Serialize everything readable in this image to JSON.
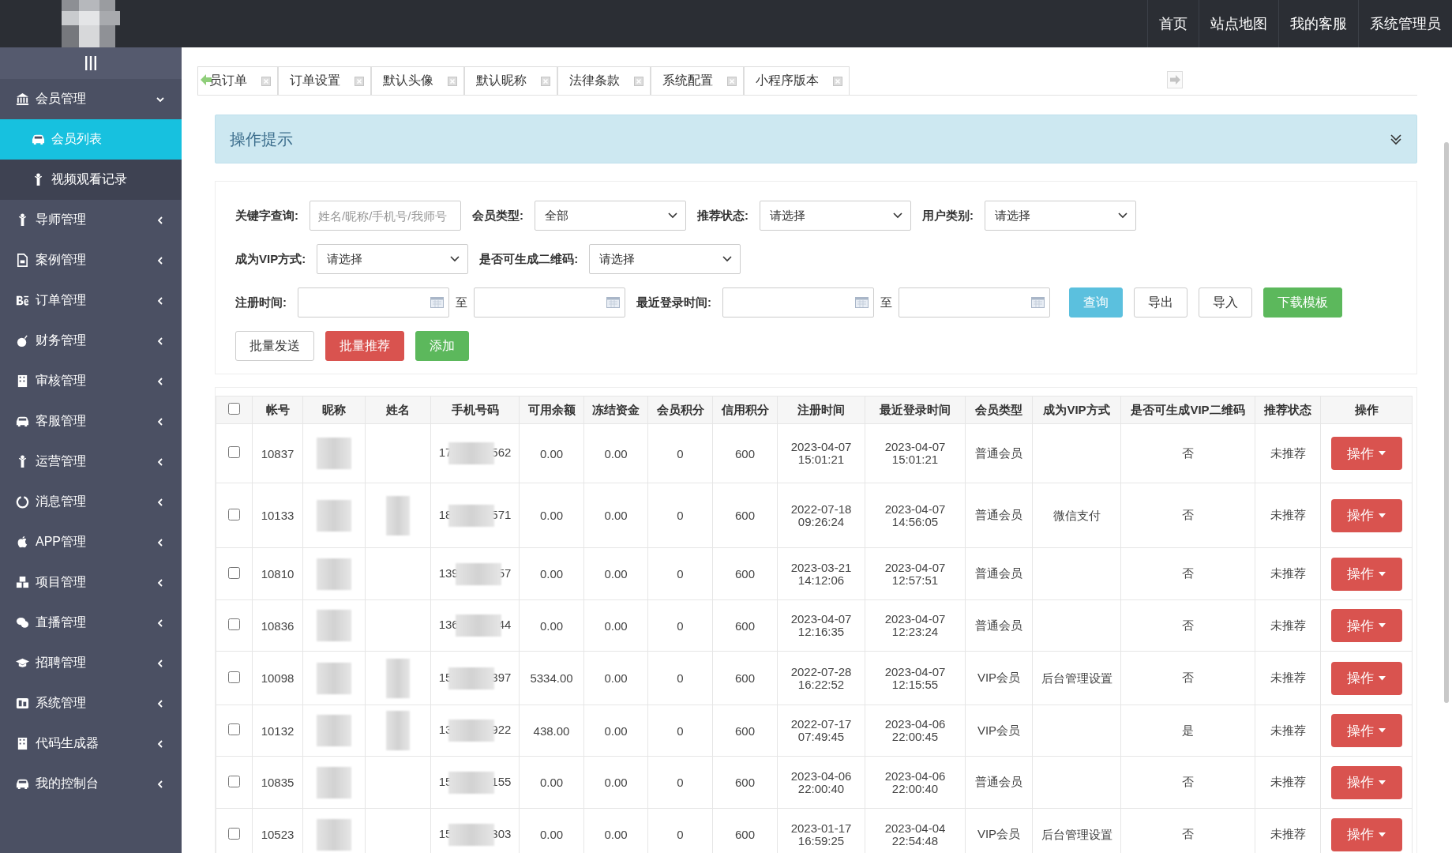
{
  "top_nav": [
    {
      "label": "首页"
    },
    {
      "label": "站点地图"
    },
    {
      "label": "我的客服"
    },
    {
      "label": "系统管理员"
    }
  ],
  "sidebar": {
    "items": [
      {
        "label": "会员管理",
        "expanded": true,
        "children": [
          {
            "label": "会员列表",
            "selected": true
          },
          {
            "label": "视频观看记录",
            "selected": false
          }
        ]
      },
      {
        "label": "导师管理",
        "expanded": false
      },
      {
        "label": "案例管理",
        "expanded": false
      },
      {
        "label": "订单管理",
        "expanded": false
      },
      {
        "label": "财务管理",
        "expanded": false
      },
      {
        "label": "审核管理",
        "expanded": false
      },
      {
        "label": "客服管理",
        "expanded": false
      },
      {
        "label": "运营管理",
        "expanded": false
      },
      {
        "label": "消息管理",
        "expanded": false
      },
      {
        "label": "APP管理",
        "expanded": false
      },
      {
        "label": "项目管理",
        "expanded": false
      },
      {
        "label": "直播管理",
        "expanded": false
      },
      {
        "label": "招聘管理",
        "expanded": false
      },
      {
        "label": "系统管理",
        "expanded": false
      },
      {
        "label": "代码生成器",
        "expanded": false
      },
      {
        "label": "我的控制台",
        "expanded": false
      }
    ]
  },
  "tabs": [
    {
      "label": "员订单",
      "selected": false
    },
    {
      "label": "订单设置",
      "selected": false
    },
    {
      "label": "默认头像",
      "selected": false
    },
    {
      "label": "默认昵称",
      "selected": false
    },
    {
      "label": "法律条款",
      "selected": false
    },
    {
      "label": "系统配置",
      "selected": false
    },
    {
      "label": "小程序版本",
      "selected": false
    }
  ],
  "tip_panel": {
    "title": "操作提示",
    "expanded": false
  },
  "filters": [
    [
      {
        "kind": "input",
        "label": "关键字查询:",
        "placeholder": "姓名/昵称/手机号/我师号"
      },
      {
        "kind": "select",
        "label": "会员类型:",
        "value": "全部"
      },
      {
        "kind": "select",
        "label": "推荐状态:",
        "value": "请选择"
      },
      {
        "kind": "select",
        "label": "用户类别:",
        "value": "请选择"
      }
    ],
    [
      {
        "kind": "select",
        "label": "成为VIP方式:",
        "value": "请选择"
      },
      {
        "kind": "select",
        "label": "是否可生成二维码:",
        "value": "请选择"
      }
    ],
    [
      {
        "kind": "range",
        "label": "注册时间:",
        "separator": "至"
      },
      {
        "kind": "range",
        "label": "最近登录时间:",
        "separator": "至"
      },
      {
        "kind": "button",
        "label": "查询"
      },
      {
        "kind": "button",
        "label": "导出"
      },
      {
        "kind": "button",
        "label": "导入"
      },
      {
        "kind": "button",
        "label": "下载模板"
      }
    ]
  ],
  "actions": [
    {
      "label": "批量发送"
    },
    {
      "label": "批量推荐"
    },
    {
      "label": "添加"
    }
  ],
  "table": {
    "select_all": {
      "checked": false
    },
    "columns": [
      "帐号",
      "昵称",
      "姓名",
      "手机号码",
      "可用余额",
      "冻结资金",
      "会员积分",
      "信用积分",
      "注册时间",
      "最近登录时间",
      "会员类型",
      "成为VIP方式",
      "是否可生成VIP二维码",
      "推荐状态",
      "操作"
    ],
    "rows": [
      {
        "checked": false,
        "account": "10837",
        "nickname_redacted": true,
        "name_redacted": false,
        "phone_start": "17",
        "phone_end": "562",
        "balance": "0.00",
        "frozen": "0.00",
        "points": "0",
        "credit": "600",
        "registered": "2023-04-07 15:01:21",
        "last_login": "2023-04-07 15:01:21",
        "member_type": "普通会员",
        "qr": "否",
        "recommend": "未推荐",
        "action": "操作"
      },
      {
        "checked": false,
        "account": "10133",
        "nickname_redacted": true,
        "name_redacted": true,
        "phone_start": "18",
        "phone_end": "571",
        "balance": "0.00",
        "frozen": "0.00",
        "points": "0",
        "credit": "600",
        "registered": "2022-07-18 09:26:24",
        "last_login": "2023-04-07 14:56:05",
        "member_type": "普通会员",
        "vip_method": "微信支付",
        "qr": "否",
        "recommend": "未推荐",
        "action": "操作"
      },
      {
        "checked": false,
        "account": "10810",
        "nickname_redacted": true,
        "name_redacted": false,
        "phone_start": "139",
        "phone_end": "57",
        "balance": "0.00",
        "frozen": "0.00",
        "points": "0",
        "credit": "600",
        "registered": "2023-03-21 14:12:06",
        "last_login": "2023-04-07 12:57:51",
        "member_type": "普通会员",
        "qr": "否",
        "recommend": "未推荐",
        "action": "操作"
      },
      {
        "checked": false,
        "account": "10836",
        "nickname_redacted": true,
        "name_redacted": false,
        "phone_start": "136",
        "phone_end": "44",
        "balance": "0.00",
        "frozen": "0.00",
        "points": "0",
        "credit": "600",
        "registered": "2023-04-07 12:16:35",
        "last_login": "2023-04-07 12:23:24",
        "member_type": "普通会员",
        "qr": "否",
        "recommend": "未推荐",
        "action": "操作"
      },
      {
        "checked": false,
        "account": "10098",
        "nickname_redacted": true,
        "name_redacted": true,
        "phone_start": "15",
        "phone_end": "397",
        "balance": "5334.00",
        "frozen": "0.00",
        "points": "0",
        "credit": "600",
        "registered": "2022-07-28 16:22:52",
        "last_login": "2023-04-07 12:15:55",
        "member_type": "VIP会员",
        "vip_method": "后台管理设置",
        "qr": "否",
        "recommend": "未推荐",
        "action": "操作"
      },
      {
        "checked": false,
        "account": "10132",
        "nickname_redacted": true,
        "name_redacted": true,
        "phone_start": "13",
        "phone_end": "922",
        "balance": "438.00",
        "frozen": "0.00",
        "points": "0",
        "credit": "600",
        "registered": "2022-07-17 07:49:45",
        "last_login": "2023-04-06 22:00:45",
        "member_type": "VIP会员",
        "qr": "是",
        "recommend": "未推荐",
        "action": "操作"
      },
      {
        "checked": false,
        "account": "10835",
        "nickname_redacted": true,
        "name_redacted": false,
        "phone_start": "15",
        "phone_end": "155",
        "balance": "0.00",
        "frozen": "0.00",
        "points": "0",
        "credit": "600",
        "registered": "2023-04-06 22:00:40",
        "last_login": "2023-04-06 22:00:40",
        "member_type": "普通会员",
        "qr": "否",
        "recommend": "未推荐",
        "action": "操作"
      },
      {
        "checked": false,
        "account": "10523",
        "nickname_redacted": true,
        "name_redacted": false,
        "phone_start": "15",
        "phone_end": "303",
        "balance": "0.00",
        "frozen": "0.00",
        "points": "0",
        "credit": "600",
        "registered": "2023-01-17 16:59:25",
        "last_login": "2023-04-04 22:54:48",
        "member_type": "VIP会员",
        "vip_method": "后台管理设置",
        "qr": "否",
        "recommend": "未推荐",
        "action": "操作"
      }
    ]
  }
}
